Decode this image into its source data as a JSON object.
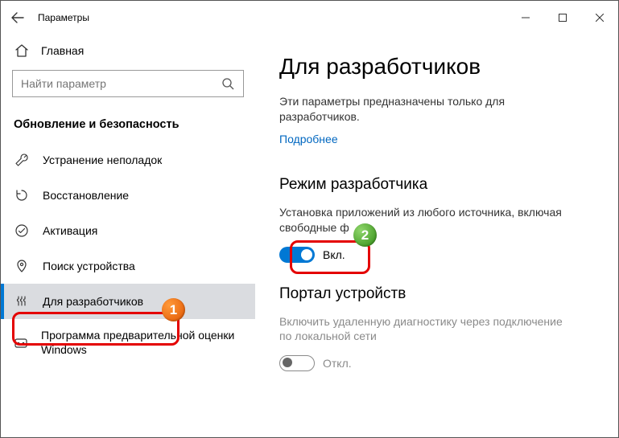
{
  "title": "Параметры",
  "sidebar": {
    "home": "Главная",
    "search_placeholder": "Найти параметр",
    "section": "Обновление и безопасность",
    "items": [
      {
        "label": "Устранение неполадок"
      },
      {
        "label": "Восстановление"
      },
      {
        "label": "Активация"
      },
      {
        "label": "Поиск устройства"
      },
      {
        "label": "Для разработчиков"
      },
      {
        "label": "Программа предварительной оценки Windows"
      }
    ]
  },
  "content": {
    "heading": "Для разработчиков",
    "intro": "Эти параметры предназначены только для разработчиков.",
    "learn_more": "Подробнее",
    "dev_mode": {
      "title": "Режим разработчика",
      "desc_line1": "Установка приложений из любого источника, включая",
      "desc_line2": "свободные ф",
      "toggle_label": "Вкл."
    },
    "device_portal": {
      "title": "Портал устройств",
      "desc": "Включить удаленную диагностику через подключение по локальной сети",
      "toggle_label": "Откл."
    }
  },
  "annotations": {
    "badge1": "1",
    "badge2": "2"
  }
}
